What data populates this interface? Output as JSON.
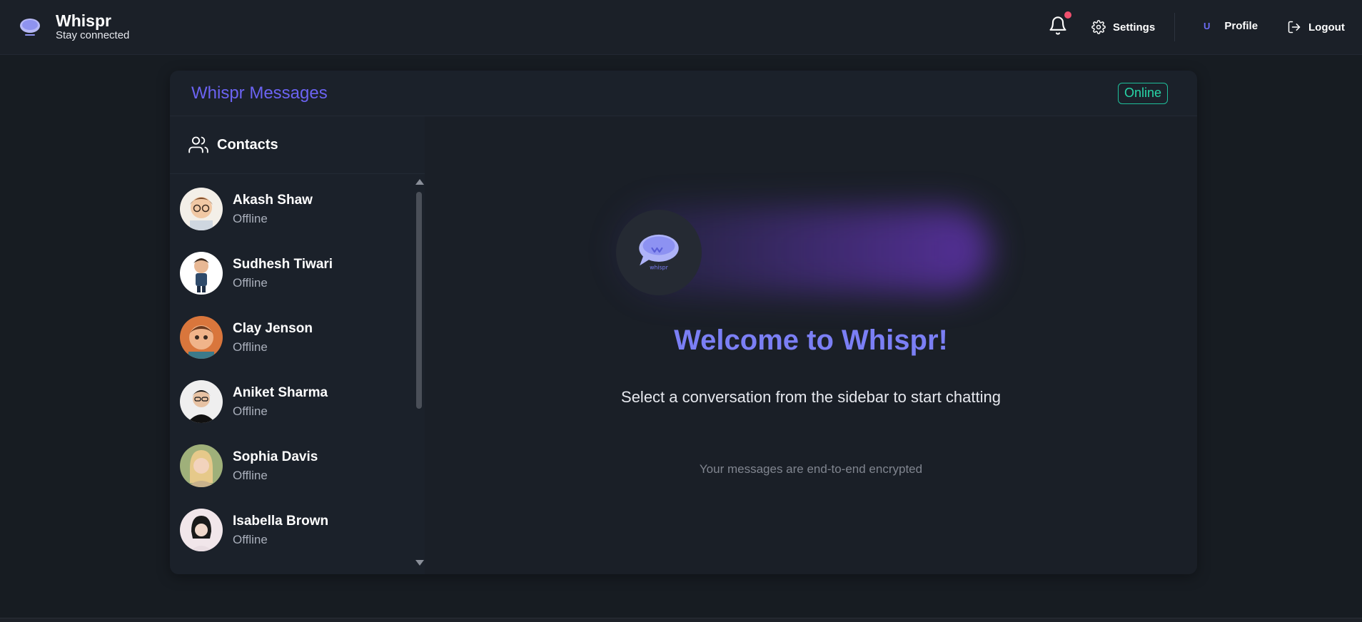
{
  "navbar": {
    "app_name": "Whispr",
    "tagline": "Stay connected",
    "settings_label": "Settings",
    "profile_initial": "U",
    "profile_label": "Profile",
    "logout_label": "Logout",
    "notification_dot_color": "#f0506e"
  },
  "card": {
    "title": "Whispr Messages",
    "status": "Online",
    "status_color": "#28d6a8"
  },
  "sidebar": {
    "title": "Contacts",
    "contacts": [
      {
        "name": "Akash Shaw",
        "status": "Offline"
      },
      {
        "name": "Sudhesh Tiwari",
        "status": "Offline"
      },
      {
        "name": "Clay Jenson",
        "status": "Offline"
      },
      {
        "name": "Aniket Sharma",
        "status": "Offline"
      },
      {
        "name": "Sophia Davis",
        "status": "Offline"
      },
      {
        "name": "Isabella Brown",
        "status": "Offline"
      }
    ]
  },
  "welcome": {
    "logo_text": "whispr",
    "title": "Welcome to Whispr!",
    "subtitle": "Select a conversation from the sidebar to start chatting",
    "note": "Your messages are end-to-end encrypted"
  },
  "colors": {
    "accent": "#6b63f2",
    "welcome_title": "#7b7ff5",
    "background": "#171c22"
  }
}
